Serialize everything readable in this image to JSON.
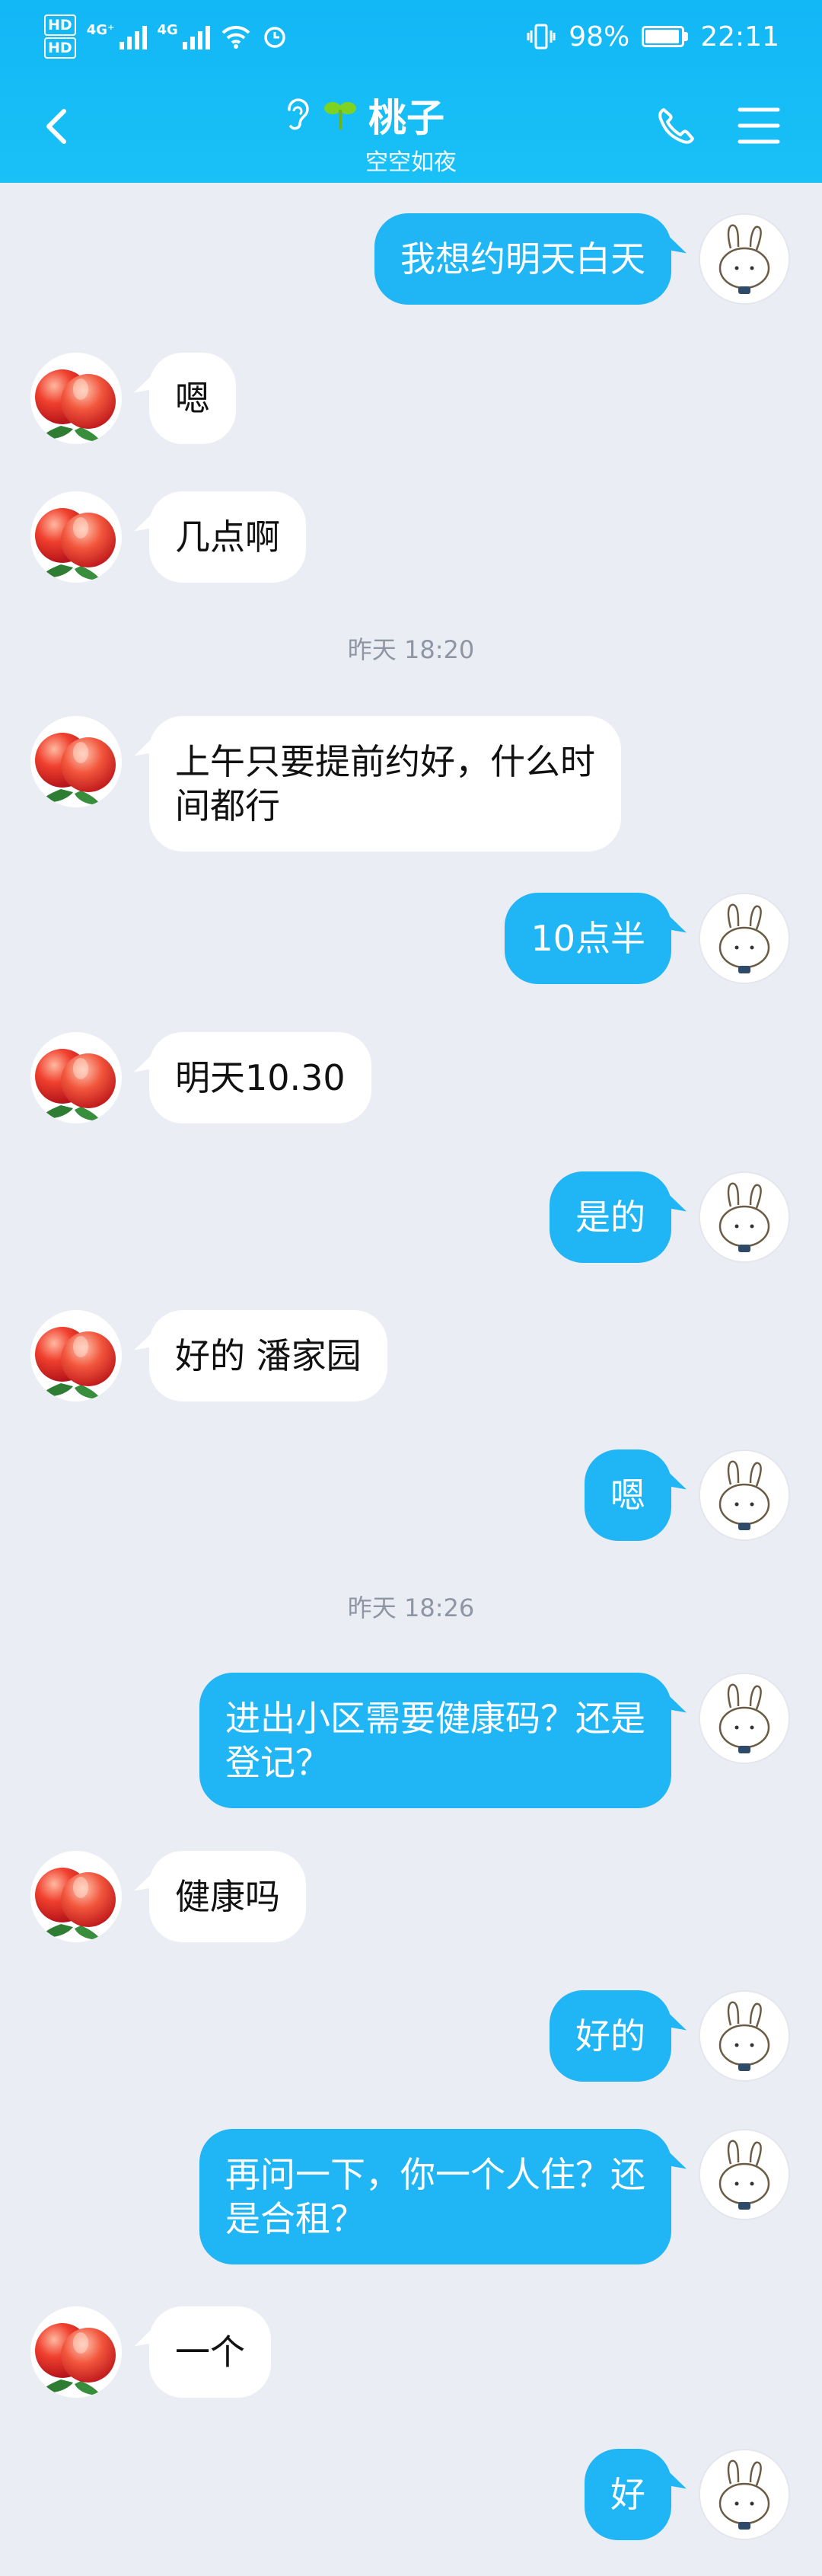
{
  "status_bar": {
    "left": [
      "HD",
      "HD"
    ],
    "network": "4G⁺",
    "network2": "4G",
    "battery": "98%",
    "time": "22:11"
  },
  "nav": {
    "title": "桃子",
    "subtitle": "空空如夜",
    "icons": [
      "back-icon",
      "ear-icon",
      "sprout-icon",
      "phone-icon",
      "menu-icon"
    ]
  },
  "colors": {
    "header": "#12B7F5",
    "self_bubble": "#20B5F5",
    "background": "#EAEDF4"
  },
  "messages": [
    {
      "side": "self",
      "text": "我想约明天白天"
    },
    {
      "side": "peer",
      "text": "嗯"
    },
    {
      "side": "peer",
      "text": "几点啊"
    },
    {
      "type": "time",
      "text": "昨天 18:20"
    },
    {
      "side": "peer",
      "text": "上午只要提前约好，什么时\n间都行"
    },
    {
      "side": "self",
      "text": "10点半"
    },
    {
      "side": "peer",
      "text": "明天10.30"
    },
    {
      "side": "self",
      "text": "是的"
    },
    {
      "side": "peer",
      "text": "好的 潘家园"
    },
    {
      "side": "self",
      "text": "嗯"
    },
    {
      "type": "time",
      "text": "昨天 18:26"
    },
    {
      "side": "self",
      "text": "进出小区需要健康码？还是\n登记？"
    },
    {
      "side": "peer",
      "text": "健康吗"
    },
    {
      "side": "self",
      "text": "好的"
    },
    {
      "side": "self",
      "text": "再问一下，你一个人住？还\n是合租？"
    },
    {
      "side": "peer",
      "text": "一个"
    },
    {
      "side": "self",
      "text": "好"
    }
  ]
}
